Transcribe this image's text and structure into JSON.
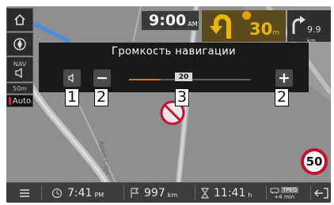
{
  "top": {
    "time": "9:00",
    "time_ampm": "AM",
    "turn_distance": "30",
    "turn_unit": "m",
    "next_distance": "9.9",
    "next_unit": "km"
  },
  "left_buttons": {
    "nav_label": "NAV",
    "scale": "50m",
    "auto": "Auto"
  },
  "volume": {
    "title": "Громкость навигации",
    "level": 20,
    "level_display": "20",
    "level_max": 35,
    "minus_label": "−",
    "plus_label": "+"
  },
  "callouts": {
    "speaker": "1",
    "minus": "2",
    "slider": "3",
    "plus": "2"
  },
  "map": {
    "street_label": "Адам-Сарс",
    "speed_limit": "50"
  },
  "bottom": {
    "time": "7:41",
    "time_ampm": "PM",
    "distance": "997",
    "distance_unit": "km",
    "duration": "11:41",
    "duration_unit": "h",
    "traffic": "+4 min",
    "traffic_badge": "TPEG"
  },
  "colors": {
    "accent": "#ff6a00",
    "turn_highlight": "#e8b800",
    "speed_sign_ring": "#c8102e"
  },
  "icons": [
    "home-icon",
    "compass-icon",
    "speaker-icon",
    "menu-icon",
    "clock-icon",
    "flag-icon",
    "traffic-icon",
    "exit-icon"
  ]
}
